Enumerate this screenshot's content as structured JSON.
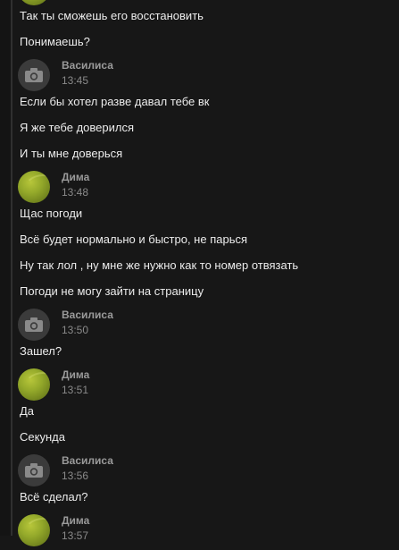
{
  "conversation": {
    "blocks": [
      {
        "messages": [
          "Так ты сможешь его восстановить",
          "Понимаешь?"
        ]
      },
      {
        "sender": "Василиса",
        "time": "13:45",
        "avatar": "camera-icon",
        "messages": [
          "Если бы хотел разве давал тебе вк",
          "Я же тебе доверился",
          "И ты мне доверься"
        ]
      },
      {
        "sender": "Дима",
        "time": "13:48",
        "avatar": "tennis-ball",
        "messages": [
          "Щас погоди",
          "Всё будет нормально и быстро, не парься",
          "Ну так лол , ну мне же нужно как то номер отвязать",
          "Погоди не могу зайти на страницу"
        ]
      },
      {
        "sender": "Василиса",
        "time": "13:50",
        "avatar": "camera-icon",
        "messages": [
          "Зашел?"
        ]
      },
      {
        "sender": "Дима",
        "time": "13:51",
        "avatar": "tennis-ball",
        "messages": [
          "Да",
          "Секунда"
        ]
      },
      {
        "sender": "Василиса",
        "time": "13:56",
        "avatar": "camera-icon",
        "messages": [
          "Всё сделал?"
        ]
      },
      {
        "sender": "Дима",
        "time": "13:57",
        "avatar": "tennis-ball",
        "messages": []
      }
    ]
  },
  "colors": {
    "background": "#171717",
    "text": "#ececec",
    "sender": "#9a9a9a",
    "time": "#8a8a8a"
  }
}
